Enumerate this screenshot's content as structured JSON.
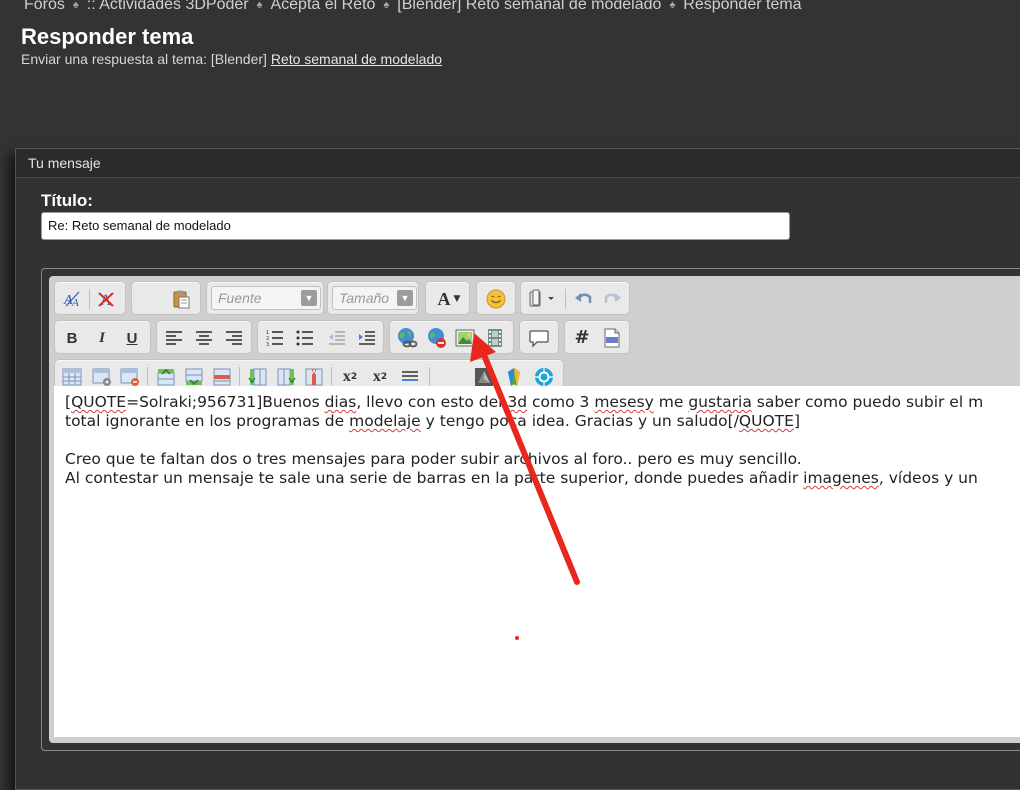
{
  "breadcrumb": {
    "items": [
      "Foros",
      ":: Actividades 3DPoder",
      "Acepta el Reto",
      "[Blender] Reto semanal de modelado",
      "Responder tema"
    ],
    "separator": "♠"
  },
  "header": {
    "title": "Responder tema",
    "subtitle_prefix": "Enviar una respuesta al tema: [Blender]",
    "subtitle_link": "Reto semanal de modelado"
  },
  "panel": {
    "heading": "Tu mensaje",
    "title_label": "Título:",
    "title_value": "Re: Reto semanal de modelado"
  },
  "toolbar": {
    "font_placeholder": "Fuente",
    "size_placeholder": "Tamaño",
    "text_color_label": "A",
    "row1_icons": [
      "remove-format-icon",
      "clear-format-icon",
      "paste-icon",
      "font-select",
      "size-select",
      "text-color-icon",
      "smiley-icon",
      "paste-special-icon",
      "undo-icon",
      "redo-icon"
    ],
    "row2_icons": [
      "bold-icon",
      "italic-icon",
      "underline-icon",
      "align-left-icon",
      "align-center-icon",
      "align-right-icon",
      "ordered-list-icon",
      "unordered-list-icon",
      "outdent-icon",
      "indent-icon",
      "insert-link-icon",
      "unlink-icon",
      "insert-image-icon",
      "insert-video-icon",
      "quote-icon",
      "code-hash-icon",
      "php-icon"
    ],
    "row3_icons": [
      "table-icon",
      "table-props-icon",
      "delete-table-icon",
      "insert-row-before-icon",
      "insert-row-after-icon",
      "delete-row-icon",
      "insert-col-before-icon",
      "insert-col-after-icon",
      "delete-col-icon",
      "subscript-icon",
      "superscript-icon",
      "horizontal-rule-icon",
      "sketchfab-icon",
      "plugin-green-icon",
      "plugin-blue-icon"
    ],
    "bold_label": "B",
    "italic_label": "I",
    "underline_label": "U",
    "hash_label": "#",
    "subscript_label": "x",
    "superscript_label": "x"
  },
  "editor": {
    "lines": [
      [
        {
          "t": "["
        },
        {
          "t": "QUOTE",
          "sp": true
        },
        {
          "t": "=Solraki;956731]Buenos "
        },
        {
          "t": "dias",
          "sp": true
        },
        {
          "t": ", llevo con esto del "
        },
        {
          "t": "3d",
          "sp": true
        },
        {
          "t": " como 3 "
        },
        {
          "t": "mesesy",
          "sp": true
        },
        {
          "t": " me "
        },
        {
          "t": "gustaria",
          "sp": true
        },
        {
          "t": " saber como puedo subir el m"
        }
      ],
      [
        {
          "t": "total ignorante en los programas de "
        },
        {
          "t": "modelaje",
          "sp": true
        },
        {
          "t": " y tengo poca idea. Gracias y un saludo[/"
        },
        {
          "t": "QUOTE",
          "sp": true
        },
        {
          "t": "]"
        }
      ],
      [],
      [
        {
          "t": "Creo que te faltan dos o tres mensajes para poder subir archivos al foro.. pero es muy sencillo."
        }
      ],
      [
        {
          "t": "Al contestar un mensaje te sale una serie de barras en la parte superior, donde puedes añadir "
        },
        {
          "t": "imagenes",
          "sp": true
        },
        {
          "t": ", vídeos y un"
        }
      ]
    ]
  },
  "annotation": {
    "arrow_color": "#e8281d",
    "dot_color": "#e82a20"
  }
}
